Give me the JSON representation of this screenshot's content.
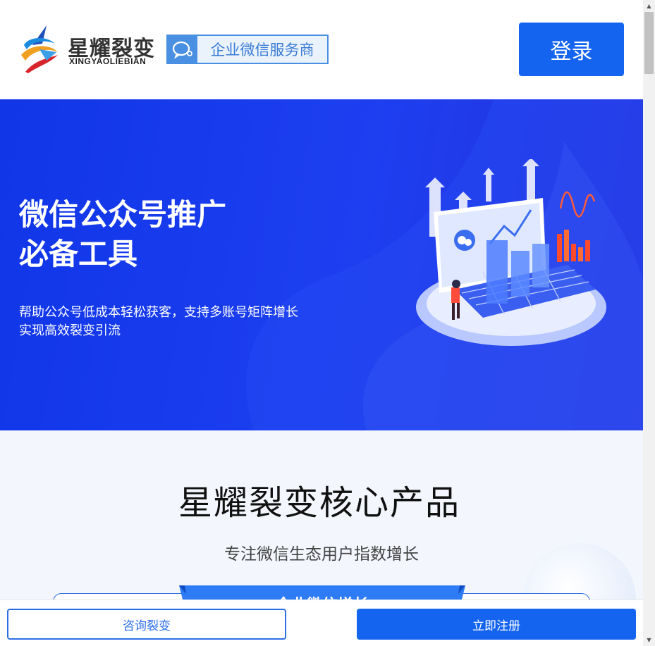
{
  "header": {
    "brand_cn": "星耀裂变",
    "brand_en": "XINGYAOLIEBIAN",
    "badge_text": "企业微信服务商",
    "login_label": "登录"
  },
  "hero": {
    "title_line1": "微信公众号推广",
    "title_line2": "必备工具",
    "subtitle_line1": "帮助公众号低成本轻松获客，支持多账号矩阵增长",
    "subtitle_line2": "实现高效裂变引流"
  },
  "products": {
    "title": "星耀裂变核心产品",
    "subtitle": "专注微信生态用户指数增长",
    "ribbon_text": "企业微信增长"
  },
  "bottom_bar": {
    "consult_label": "咨询裂变",
    "register_label": "立即注册"
  },
  "colors": {
    "primary": "#1464f0",
    "hero_bg": "#1036e8",
    "section_bg": "#f3f6fd"
  }
}
